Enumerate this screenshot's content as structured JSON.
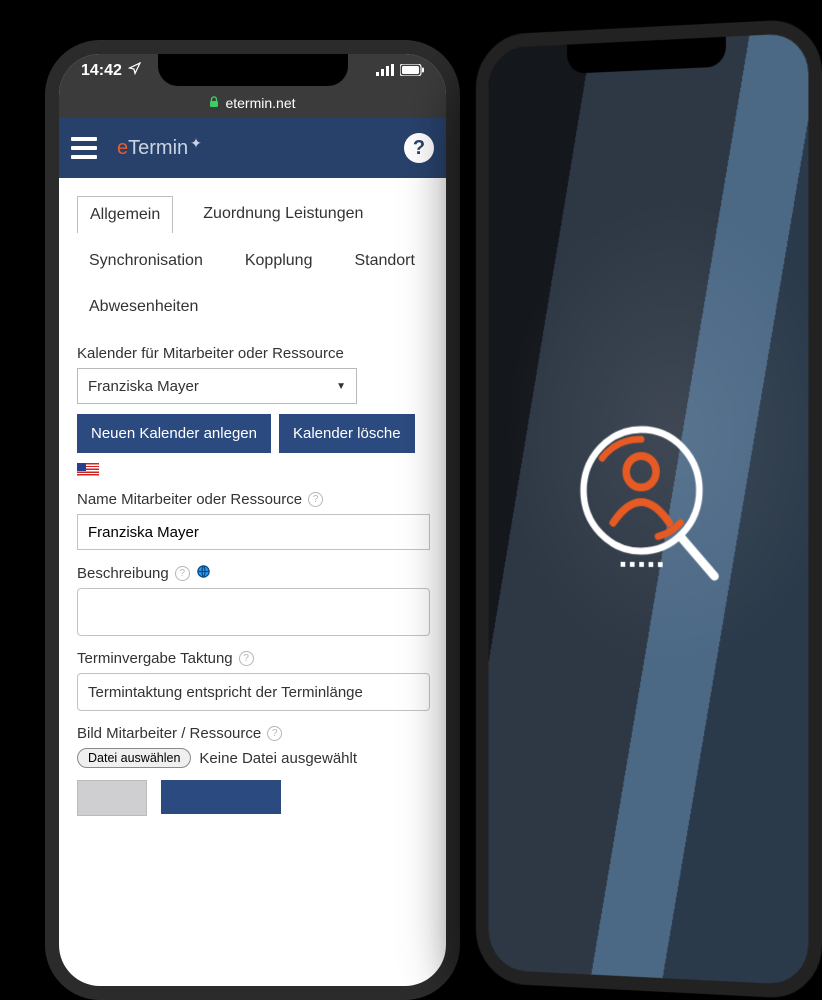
{
  "status": {
    "time": "14:42",
    "domain": "etermin.net"
  },
  "logo": {
    "part1": "e",
    "part2": "Termin"
  },
  "tabs": {
    "allgemein": "Allgemein",
    "zuordnung": "Zuordnung Leistungen",
    "sync": "Synchronisation",
    "kopplung": "Kopplung",
    "standort": "Standort",
    "abwesen": "Abwesenheiten"
  },
  "cal": {
    "label": "Kalender für Mitarbeiter oder Ressource",
    "selected": "Franziska Mayer",
    "new_btn": "Neuen Kalender anlegen",
    "del_btn": "Kalender lösche"
  },
  "name": {
    "label": "Name Mitarbeiter oder Ressource",
    "value": "Franziska Mayer"
  },
  "desc": {
    "label": "Beschreibung"
  },
  "takt": {
    "label": "Terminvergabe Taktung",
    "value": "Termintaktung entspricht der Terminlänge"
  },
  "bild": {
    "label": "Bild Mitarbeiter / Ressource",
    "file_btn": "Datei auswählen",
    "file_state": "Keine Datei ausgewählt"
  }
}
